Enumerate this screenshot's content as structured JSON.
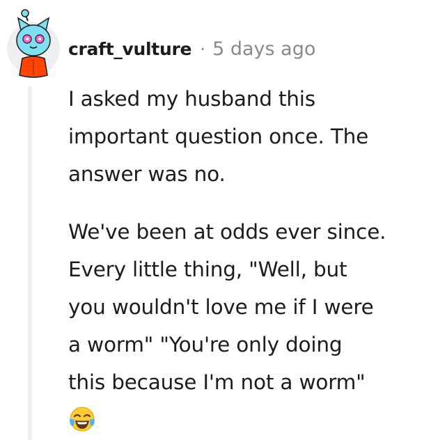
{
  "comment": {
    "username": "craft_vulture",
    "separator": "·",
    "timestamp": "5 days ago",
    "paragraphs": [
      [
        "I asked my husband this",
        "important question once. The",
        "answer was no."
      ],
      [
        "We've been at odds ever since.",
        "Every little thing, \"Well, but",
        "you wouldn't love me if I were",
        "a worm\" \"You're only doing",
        "this because I'm not a worm\""
      ]
    ],
    "emoji": "face-with-tears-of-joy-icon",
    "avatar": "snoo-avatar-cat-orange-hoodie"
  },
  "colors": {
    "text": "#1c1c1c",
    "meta": "#878a8c",
    "thread_line": "#edeff1",
    "avatar_bg": "#edeff1",
    "avatar_head": "#7ee0f0",
    "avatar_hoodie": "#ff4500",
    "emoji_face": "#ffcc33"
  }
}
